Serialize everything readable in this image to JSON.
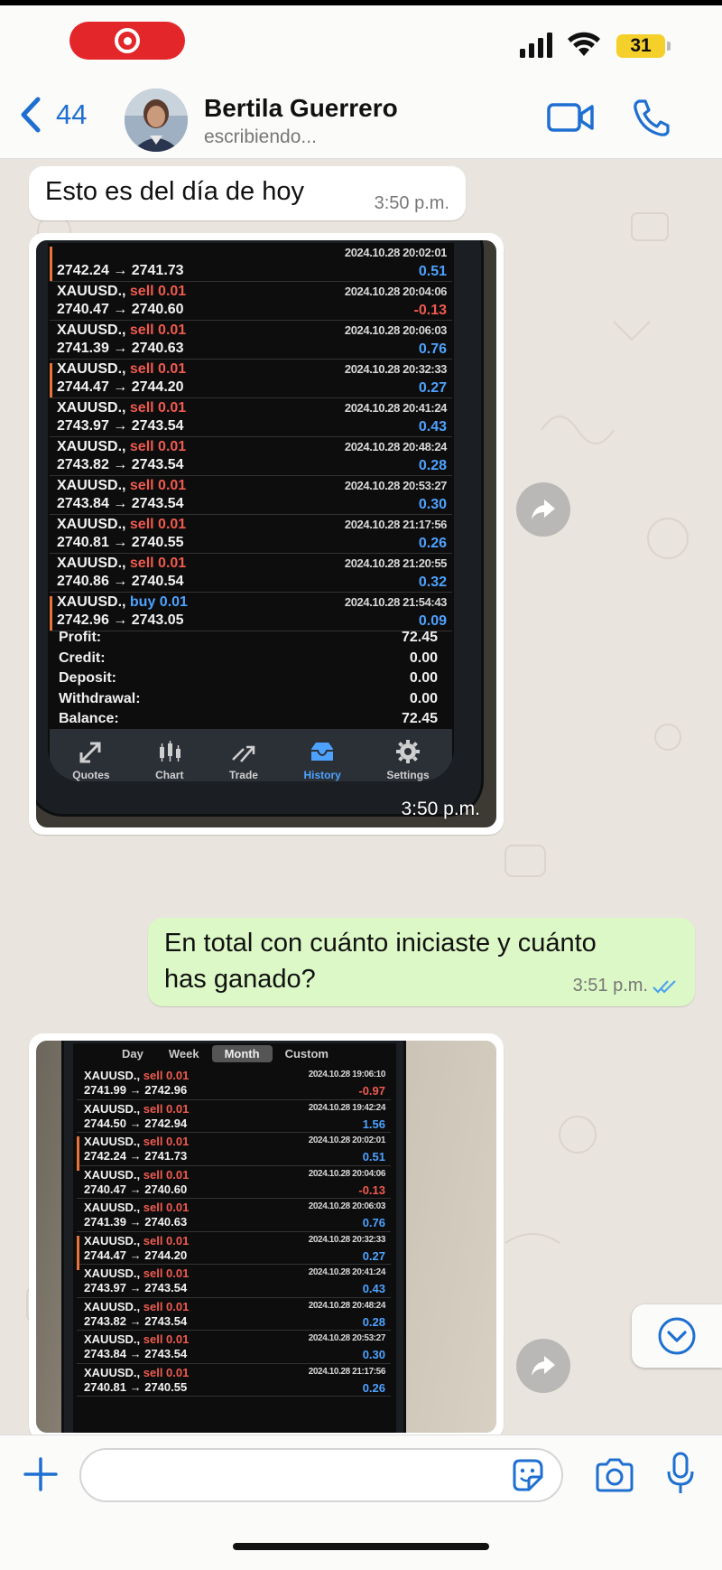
{
  "status_bar": {
    "battery": "31",
    "icons": [
      "screen-recording-icon",
      "cellular-signal-icon",
      "wifi-icon",
      "battery-icon"
    ]
  },
  "header": {
    "back_count": "44",
    "contact_name": "Bertila Guerrero",
    "contact_status": "escribiendo...",
    "icons": [
      "chevron-left-icon",
      "video-call-icon",
      "phone-call-icon"
    ]
  },
  "messages": [
    {
      "type": "text",
      "direction": "incoming",
      "text": "Esto es del día de hoy",
      "time": "3:50 p.m."
    },
    {
      "type": "image",
      "direction": "incoming",
      "time": "3:50 p.m."
    },
    {
      "type": "text",
      "direction": "outgoing",
      "line1": "En total con cuánto iniciaste y cuánto",
      "line2": "has ganado?",
      "time": "3:51 p.m.",
      "read": true
    },
    {
      "type": "image",
      "direction": "incoming"
    }
  ],
  "screenshot1": {
    "trades": [
      {
        "symbol": "",
        "side": "",
        "prices": "2742.24 → 2741.73",
        "date": "2024.10.28 20:02:01",
        "pl": "0.51",
        "neg": false,
        "marked": true
      },
      {
        "symbol": "XAUUSD.,",
        "side": "sell 0.01",
        "prices": "2740.47 → 2740.60",
        "date": "2024.10.28 20:04:06",
        "pl": "-0.13",
        "neg": true,
        "marked": false
      },
      {
        "symbol": "XAUUSD.,",
        "side": "sell 0.01",
        "prices": "2741.39 → 2740.63",
        "date": "2024.10.28 20:06:03",
        "pl": "0.76",
        "neg": false,
        "marked": false
      },
      {
        "symbol": "XAUUSD.,",
        "side": "sell 0.01",
        "prices": "2744.47 → 2744.20",
        "date": "2024.10.28 20:32:33",
        "pl": "0.27",
        "neg": false,
        "marked": true
      },
      {
        "symbol": "XAUUSD.,",
        "side": "sell 0.01",
        "prices": "2743.97 → 2743.54",
        "date": "2024.10.28 20:41:24",
        "pl": "0.43",
        "neg": false,
        "marked": false
      },
      {
        "symbol": "XAUUSD.,",
        "side": "sell 0.01",
        "prices": "2743.82 → 2743.54",
        "date": "2024.10.28 20:48:24",
        "pl": "0.28",
        "neg": false,
        "marked": false
      },
      {
        "symbol": "XAUUSD.,",
        "side": "sell 0.01",
        "prices": "2743.84 → 2743.54",
        "date": "2024.10.28 20:53:27",
        "pl": "0.30",
        "neg": false,
        "marked": false
      },
      {
        "symbol": "XAUUSD.,",
        "side": "sell 0.01",
        "prices": "2740.81 → 2740.55",
        "date": "2024.10.28 21:17:56",
        "pl": "0.26",
        "neg": false,
        "marked": false
      },
      {
        "symbol": "XAUUSD.,",
        "side": "sell 0.01",
        "prices": "2740.86 → 2740.54",
        "date": "2024.10.28 21:20:55",
        "pl": "0.32",
        "neg": false,
        "marked": false
      },
      {
        "symbol": "XAUUSD.,",
        "side": "buy 0.01",
        "prices": "2742.96 → 2743.05",
        "date": "2024.10.28 21:54:43",
        "pl": "0.09",
        "neg": false,
        "marked": true,
        "buy": true
      }
    ],
    "summary": [
      {
        "label": "Profit:",
        "value": "72.45"
      },
      {
        "label": "Credit:",
        "value": "0.00"
      },
      {
        "label": "Deposit:",
        "value": "0.00"
      },
      {
        "label": "Withdrawal:",
        "value": "0.00"
      },
      {
        "label": "Balance:",
        "value": "72.45"
      }
    ],
    "tabs": [
      {
        "label": "Quotes",
        "icon": "quotes-icon",
        "active": false
      },
      {
        "label": "Chart",
        "icon": "chart-icon",
        "active": false
      },
      {
        "label": "Trade",
        "icon": "trade-icon",
        "active": false
      },
      {
        "label": "History",
        "icon": "history-icon",
        "active": true
      },
      {
        "label": "Settings",
        "icon": "settings-icon",
        "active": false
      }
    ]
  },
  "screenshot2": {
    "period_tabs": [
      "Day",
      "Week",
      "Month",
      "Custom"
    ],
    "selected_period": "Month",
    "trades": [
      {
        "symbol": "XAUUSD.,",
        "side": "sell 0.01",
        "prices": "2741.99 → 2742.96",
        "date": "2024.10.28 19:06:10",
        "pl": "-0.97",
        "neg": true,
        "marked": false
      },
      {
        "symbol": "XAUUSD.,",
        "side": "sell 0.01",
        "prices": "2744.50 → 2742.94",
        "date": "2024.10.28 19:42:24",
        "pl": "1.56",
        "neg": false,
        "marked": false
      },
      {
        "symbol": "XAUUSD.,",
        "side": "sell 0.01",
        "prices": "2742.24 → 2741.73",
        "date": "2024.10.28 20:02:01",
        "pl": "0.51",
        "neg": false,
        "marked": true
      },
      {
        "symbol": "XAUUSD.,",
        "side": "sell 0.01",
        "prices": "2740.47 → 2740.60",
        "date": "2024.10.28 20:04:06",
        "pl": "-0.13",
        "neg": true,
        "marked": false
      },
      {
        "symbol": "XAUUSD.,",
        "side": "sell 0.01",
        "prices": "2741.39 → 2740.63",
        "date": "2024.10.28 20:06:03",
        "pl": "0.76",
        "neg": false,
        "marked": false
      },
      {
        "symbol": "XAUUSD.,",
        "side": "sell 0.01",
        "prices": "2744.47 → 2744.20",
        "date": "2024.10.28 20:32:33",
        "pl": "0.27",
        "neg": false,
        "marked": true
      },
      {
        "symbol": "XAUUSD.,",
        "side": "sell 0.01",
        "prices": "2743.97 → 2743.54",
        "date": "2024.10.28 20:41:24",
        "pl": "0.43",
        "neg": false,
        "marked": false
      },
      {
        "symbol": "XAUUSD.,",
        "side": "sell 0.01",
        "prices": "2743.82 → 2743.54",
        "date": "2024.10.28 20:48:24",
        "pl": "0.28",
        "neg": false,
        "marked": false
      },
      {
        "symbol": "XAUUSD.,",
        "side": "sell 0.01",
        "prices": "2743.84 → 2743.54",
        "date": "2024.10.28 20:53:27",
        "pl": "0.30",
        "neg": false,
        "marked": false
      },
      {
        "symbol": "XAUUSD.,",
        "side": "sell 0.01",
        "prices": "2740.81 → 2740.55",
        "date": "2024.10.28 21:17:56",
        "pl": "0.26",
        "neg": false,
        "marked": false
      }
    ]
  },
  "input": {
    "placeholder": "",
    "icons": [
      "plus-icon",
      "sticker-icon",
      "camera-icon",
      "microphone-icon"
    ]
  },
  "colors": {
    "accent": "#1e6fd1",
    "outgoing_bubble": "#dcf8c6",
    "chat_background": "#e9e4dd",
    "sell": "#ef5a4f",
    "buy": "#4ea2ff"
  }
}
